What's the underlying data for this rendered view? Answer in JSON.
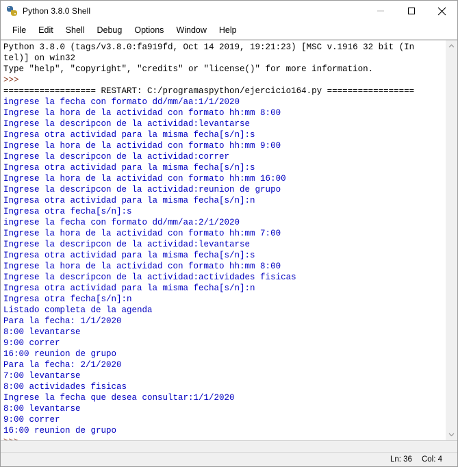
{
  "window": {
    "title": "Python 3.8.0 Shell",
    "icon": "python-logo-icon",
    "controls": {
      "minimize": "minimize-button",
      "maximize": "maximize-button",
      "close": "close-button"
    }
  },
  "menu": {
    "items": [
      {
        "label": "File"
      },
      {
        "label": "Edit"
      },
      {
        "label": "Shell"
      },
      {
        "label": "Debug"
      },
      {
        "label": "Options"
      },
      {
        "label": "Window"
      },
      {
        "label": "Help"
      }
    ]
  },
  "shell": {
    "lines": [
      {
        "text": "Python 3.8.0 (tags/v3.8.0:fa919fd, Oct 14 2019, 19:21:23) [MSC v.1916 32 bit (In",
        "style": "black"
      },
      {
        "text": "tel)] on win32",
        "style": "black"
      },
      {
        "text": "Type \"help\", \"copyright\", \"credits\" or \"license()\" for more information.",
        "style": "black"
      },
      {
        "text": ">>> ",
        "style": "prompt"
      },
      {
        "text": "================== RESTART: C:/programaspython/ejercicio164.py =================",
        "style": "black"
      },
      {
        "text": "ingrese la fecha con formato dd/mm/aa:1/1/2020",
        "style": "blue"
      },
      {
        "text": "Ingrese la hora de la actividad con formato hh:mm 8:00",
        "style": "blue"
      },
      {
        "text": "Ingrese la descripcon de la actividad:levantarse",
        "style": "blue"
      },
      {
        "text": "Ingresa otra actividad para la misma fecha[s/n]:s",
        "style": "blue"
      },
      {
        "text": "Ingrese la hora de la actividad con formato hh:mm 9:00",
        "style": "blue"
      },
      {
        "text": "Ingrese la descripcon de la actividad:correr",
        "style": "blue"
      },
      {
        "text": "Ingresa otra actividad para la misma fecha[s/n]:s",
        "style": "blue"
      },
      {
        "text": "Ingrese la hora de la actividad con formato hh:mm 16:00",
        "style": "blue"
      },
      {
        "text": "Ingrese la descripcon de la actividad:reunion de grupo",
        "style": "blue"
      },
      {
        "text": "Ingresa otra actividad para la misma fecha[s/n]:n",
        "style": "blue"
      },
      {
        "text": "Ingresa otra fecha[s/n]:s",
        "style": "blue"
      },
      {
        "text": "ingrese la fecha con formato dd/mm/aa:2/1/2020",
        "style": "blue"
      },
      {
        "text": "Ingrese la hora de la actividad con formato hh:mm 7:00",
        "style": "blue"
      },
      {
        "text": "Ingrese la descripcon de la actividad:levantarse",
        "style": "blue"
      },
      {
        "text": "Ingresa otra actividad para la misma fecha[s/n]:s",
        "style": "blue"
      },
      {
        "text": "Ingrese la hora de la actividad con formato hh:mm 8:00",
        "style": "blue"
      },
      {
        "text": "Ingrese la descripcon de la actividad:actividades fisicas",
        "style": "blue"
      },
      {
        "text": "Ingresa otra actividad para la misma fecha[s/n]:n",
        "style": "blue"
      },
      {
        "text": "Ingresa otra fecha[s/n]:n",
        "style": "blue"
      },
      {
        "text": "Listado completa de la agenda",
        "style": "blue"
      },
      {
        "text": "Para la fecha: 1/1/2020",
        "style": "blue"
      },
      {
        "text": "8:00 levantarse",
        "style": "blue"
      },
      {
        "text": "9:00 correr",
        "style": "blue"
      },
      {
        "text": "16:00 reunion de grupo",
        "style": "blue"
      },
      {
        "text": "Para la fecha: 2/1/2020",
        "style": "blue"
      },
      {
        "text": "7:00 levantarse",
        "style": "blue"
      },
      {
        "text": "8:00 actividades fisicas",
        "style": "blue"
      },
      {
        "text": "Ingrese la fecha que desea consultar:1/1/2020",
        "style": "blue"
      },
      {
        "text": "8:00 levantarse",
        "style": "blue"
      },
      {
        "text": "9:00 correr",
        "style": "blue"
      },
      {
        "text": "16:00 reunion de grupo",
        "style": "blue"
      },
      {
        "text": ">>> ",
        "style": "prompt"
      }
    ]
  },
  "scrollbar": {
    "up_arrow_icon": "chevron-up-icon",
    "down_arrow_icon": "chevron-down-icon"
  },
  "statusbar": {
    "line_label": "Ln: 36",
    "col_label": "Col: 4"
  },
  "colors": {
    "output_blue": "#0000c0",
    "prompt_brown": "#8b3a20",
    "stdout_black": "#000000",
    "chrome_gray": "#f0f0f0"
  }
}
